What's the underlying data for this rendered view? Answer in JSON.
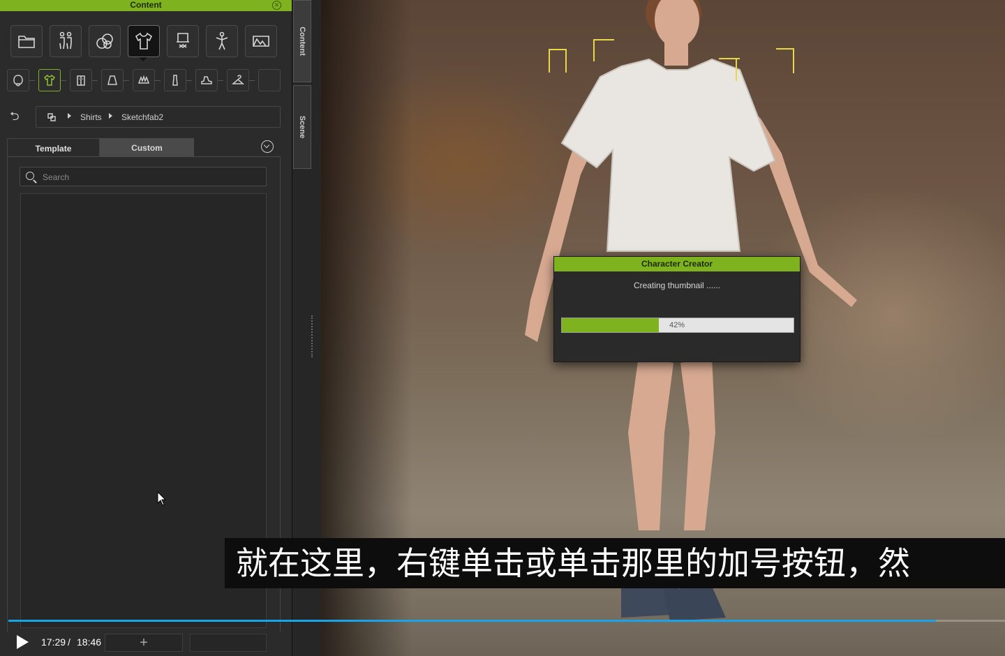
{
  "content_panel": {
    "title": "Content",
    "close_icon": "close-circle-icon",
    "categories": [
      {
        "name": "folder",
        "icon": "folder-icon"
      },
      {
        "name": "body",
        "icon": "body-icon"
      },
      {
        "name": "material",
        "icon": "material-icon"
      },
      {
        "name": "cloth",
        "icon": "cloth-icon",
        "active": true
      },
      {
        "name": "accessory",
        "icon": "accessory-icon"
      },
      {
        "name": "pose",
        "icon": "pose-icon"
      },
      {
        "name": "stage",
        "icon": "stage-icon"
      }
    ],
    "sub_categories": [
      {
        "icon": "hair-icon"
      },
      {
        "icon": "shirt-icon",
        "active": true
      },
      {
        "icon": "jacket-icon"
      },
      {
        "icon": "skirt-icon"
      },
      {
        "icon": "gloves-icon"
      },
      {
        "icon": "dress-icon"
      },
      {
        "icon": "shoe-icon"
      },
      {
        "icon": "hanger-icon"
      },
      {
        "icon": "empty-slot-icon"
      }
    ],
    "breadcrumb": {
      "back_icon": "back-arrow-icon",
      "items": [
        "Shirts",
        "Sketchfab2"
      ]
    },
    "tabs": [
      {
        "label": "Template",
        "active": false
      },
      {
        "label": "Custom",
        "active": true
      }
    ],
    "search": {
      "placeholder": "Search",
      "value": ""
    },
    "bottom_add_label": "+"
  },
  "dock": {
    "tabs": [
      "Content",
      "Scene"
    ]
  },
  "dialog": {
    "title": "Character Creator",
    "message": "Creating thumbnail ......",
    "progress_percent": 42,
    "progress_label": "42%",
    "accent_color": "#7fb21f"
  },
  "subtitle": {
    "text": "就在这里，右键单击或单击那里的加号按钮，然"
  },
  "player": {
    "current_time": "17:29",
    "separator": "/",
    "total_time": "18:46",
    "played_fraction": 0.931,
    "accent_color": "#1aa3e8"
  }
}
